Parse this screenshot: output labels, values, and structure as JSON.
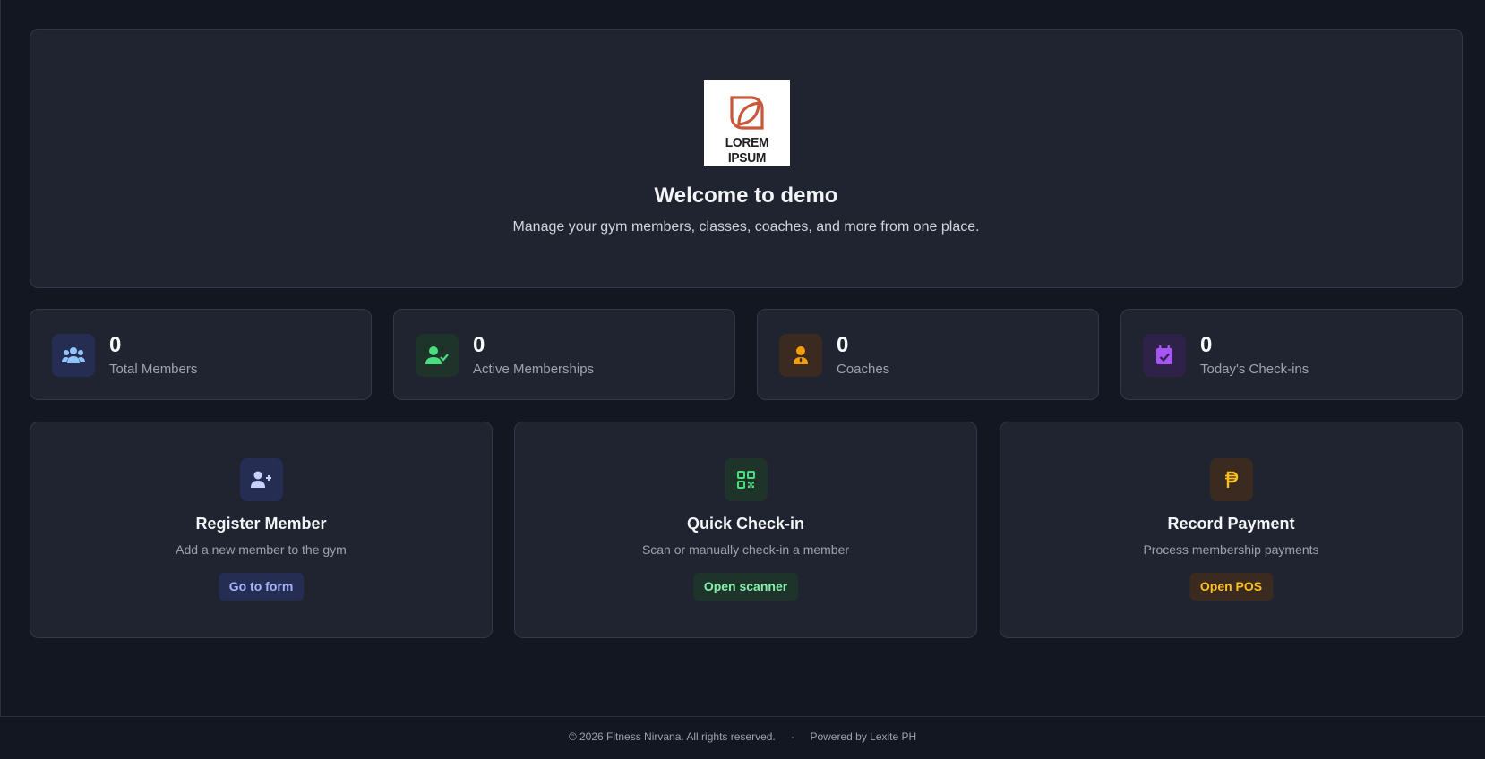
{
  "hero": {
    "logo_text": "LOREM IPSUM",
    "title": "Welcome to demo",
    "subtitle": "Manage your gym members, classes, coaches, and more from one place."
  },
  "stats": [
    {
      "value": "0",
      "label": "Total Members",
      "icon": "users-icon",
      "color": "#93c5fd",
      "bg": "#262d52"
    },
    {
      "value": "0",
      "label": "Active Memberships",
      "icon": "user-check-icon",
      "color": "#4ade80",
      "bg": "#1e3329"
    },
    {
      "value": "0",
      "label": "Coaches",
      "icon": "coach-icon",
      "color": "#f59e0b",
      "bg": "#3a2a1f"
    },
    {
      "value": "0",
      "label": "Today's Check-ins",
      "icon": "calendar-check-icon",
      "color": "#a855f7",
      "bg": "#2e2248"
    }
  ],
  "actions": [
    {
      "title": "Register Member",
      "description": "Add a new member to the gym",
      "button": "Go to form",
      "icon": "user-plus-icon",
      "color": "#a5b4fc",
      "bg": "#262d52"
    },
    {
      "title": "Quick Check-in",
      "description": "Scan or manually check-in a member",
      "button": "Open scanner",
      "icon": "qr-code-icon",
      "color": "#4ade80",
      "bg": "#1e3329"
    },
    {
      "title": "Record Payment",
      "description": "Process membership payments",
      "button": "Open POS",
      "icon": "peso-icon",
      "color": "#fbbf24",
      "bg": "#3a2a1f"
    }
  ],
  "footer": {
    "copyright": "© 2026 Fitness Nirvana. All rights reserved.",
    "separator": "·",
    "powered": "Powered by Lexite PH"
  }
}
